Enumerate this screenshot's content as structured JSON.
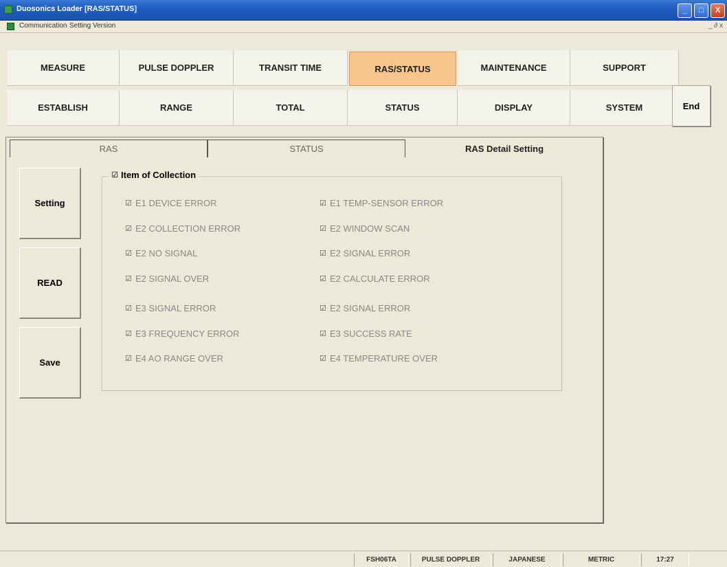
{
  "window": {
    "title": "Duosonics Loader  [RAS/STATUS]",
    "min_glyph": "_",
    "max_glyph": "□",
    "close_glyph": "X"
  },
  "menubar": {
    "items": [
      "Communication",
      "Setting",
      "Version"
    ],
    "mdi_controls": "_ ∂ x"
  },
  "nav": {
    "row1": [
      "MEASURE",
      "PULSE DOPPLER",
      "TRANSIT TIME",
      "RAS/STATUS",
      "MAINTENANCE",
      "SUPPORT"
    ],
    "row2": [
      "ESTABLISH",
      "RANGE",
      "TOTAL",
      "STATUS",
      "DISPLAY",
      "SYSTEM"
    ],
    "active": "RAS/STATUS",
    "end_label": "End",
    "active_color": "#f8c58e"
  },
  "tabs": [
    "RAS",
    "STATUS",
    "RAS Detail Setting"
  ],
  "side_buttons": [
    "Setting",
    "READ",
    "Save"
  ],
  "group": {
    "title": "Item of Collection",
    "check_glyph": "☑",
    "left_items": [
      "E1 DEVICE ERROR",
      "E2 COLLECTION ERROR",
      "E2 NO SIGNAL",
      "E2 SIGNAL OVER",
      "E3 SIGNAL ERROR",
      "E3 FREQUENCY ERROR",
      "E4 AO RANGE OVER"
    ],
    "right_items": [
      "E1 TEMP-SENSOR ERROR",
      "E2 WINDOW SCAN",
      "E2 SIGNAL ERROR",
      "E2 CALCULATE ERROR",
      "E2 SIGNAL ERROR",
      "E3 SUCCESS RATE",
      "E4 TEMPERATURE OVER"
    ]
  },
  "statusbar": {
    "model": "FSH06TA",
    "mode": "PULSE DOPPLER",
    "language": "JAPANESE",
    "unit": "METRIC",
    "time": "17:27"
  }
}
